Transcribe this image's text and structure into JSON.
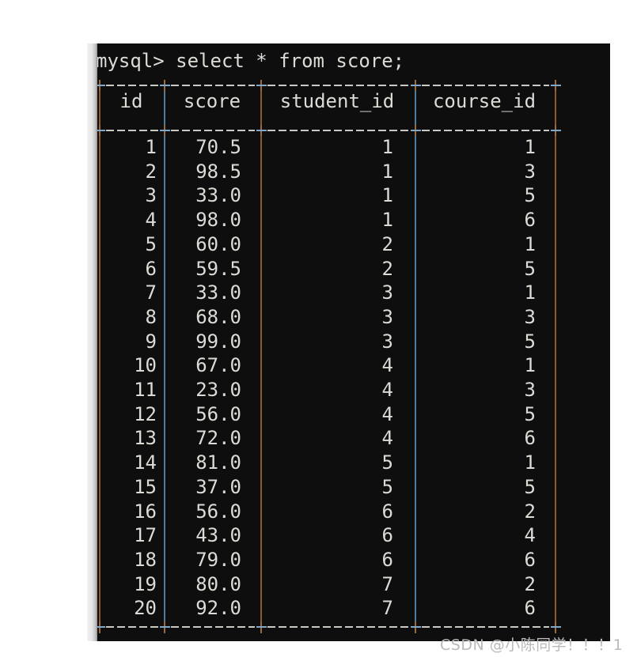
{
  "terminal": {
    "prompt": "mysql> select * from score;",
    "top_rule": "+----+--------+------------+-----------+",
    "header_rule": "+----+--------+------------+-----------+",
    "bottom_rule": "+----+--------+------------+-----------+"
  },
  "table": {
    "headers": [
      "id",
      "score",
      "student_id",
      "course_id"
    ],
    "rows": [
      {
        "id": "1",
        "score": "70.5",
        "student_id": "1",
        "course_id": "1"
      },
      {
        "id": "2",
        "score": "98.5",
        "student_id": "1",
        "course_id": "3"
      },
      {
        "id": "3",
        "score": "33.0",
        "student_id": "1",
        "course_id": "5"
      },
      {
        "id": "4",
        "score": "98.0",
        "student_id": "1",
        "course_id": "6"
      },
      {
        "id": "5",
        "score": "60.0",
        "student_id": "2",
        "course_id": "1"
      },
      {
        "id": "6",
        "score": "59.5",
        "student_id": "2",
        "course_id": "5"
      },
      {
        "id": "7",
        "score": "33.0",
        "student_id": "3",
        "course_id": "1"
      },
      {
        "id": "8",
        "score": "68.0",
        "student_id": "3",
        "course_id": "3"
      },
      {
        "id": "9",
        "score": "99.0",
        "student_id": "3",
        "course_id": "5"
      },
      {
        "id": "10",
        "score": "67.0",
        "student_id": "4",
        "course_id": "1"
      },
      {
        "id": "11",
        "score": "23.0",
        "student_id": "4",
        "course_id": "3"
      },
      {
        "id": "12",
        "score": "56.0",
        "student_id": "4",
        "course_id": "5"
      },
      {
        "id": "13",
        "score": "72.0",
        "student_id": "4",
        "course_id": "6"
      },
      {
        "id": "14",
        "score": "81.0",
        "student_id": "5",
        "course_id": "1"
      },
      {
        "id": "15",
        "score": "37.0",
        "student_id": "5",
        "course_id": "5"
      },
      {
        "id": "16",
        "score": "56.0",
        "student_id": "6",
        "course_id": "2"
      },
      {
        "id": "17",
        "score": "43.0",
        "student_id": "6",
        "course_id": "4"
      },
      {
        "id": "18",
        "score": "79.0",
        "student_id": "6",
        "course_id": "6"
      },
      {
        "id": "19",
        "score": "80.0",
        "student_id": "7",
        "course_id": "2"
      },
      {
        "id": "20",
        "score": "92.0",
        "student_id": "7",
        "course_id": "6"
      }
    ]
  },
  "watermark": {
    "text": "CSDN @小陈同学！！！1"
  },
  "colors": {
    "terminal_background": "#0e0e0e",
    "page_background": "#ffffff",
    "text": "#dcdcd6",
    "rule_dash": "#c9c9c4",
    "pipe_warm": "#8a5a2c",
    "pipe_cool": "#4c7f9e",
    "watermark": "#b9b9b9"
  }
}
